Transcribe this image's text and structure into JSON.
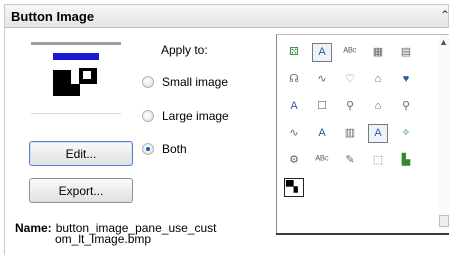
{
  "panel": {
    "title": "Button Image",
    "collapse_icon": "double-chevron-icon"
  },
  "apply": {
    "label": "Apply to:",
    "options": [
      {
        "label": "Small image",
        "checked": false
      },
      {
        "label": "Large image",
        "checked": false
      },
      {
        "label": "Both",
        "checked": true
      }
    ]
  },
  "buttons": {
    "edit": "Edit...",
    "export": "Export..."
  },
  "name": {
    "label": "Name:",
    "value_line1": "button_image_pane_use_cust",
    "value_line2": "om_lt_Image.bmp"
  },
  "gallery": {
    "icons": [
      {
        "name": "puzzle-icon",
        "glyph": "⚄",
        "style": "green"
      },
      {
        "name": "text-box-a-icon",
        "glyph": "A",
        "style": "boxed"
      },
      {
        "name": "abc-spell-icon",
        "glyph": "ᴬᴮᶜ",
        "style": "gray"
      },
      {
        "name": "table-icon",
        "glyph": "▦",
        "style": "gray"
      },
      {
        "name": "form-icon",
        "glyph": "▤",
        "style": "gray"
      },
      {
        "name": "callout-shape-icon",
        "glyph": "☊",
        "style": "gray"
      },
      {
        "name": "waveform-icon",
        "glyph": "∿",
        "style": "gray"
      },
      {
        "name": "heart-callout-icon",
        "glyph": "♡",
        "style": "gray"
      },
      {
        "name": "speech-shape-icon",
        "glyph": "⌂",
        "style": "gray"
      },
      {
        "name": "heart-badge-icon",
        "glyph": "♥",
        "style": ""
      },
      {
        "name": "text-a-underline-icon",
        "glyph": "A",
        "style": ""
      },
      {
        "name": "speech-bubble-icon",
        "glyph": "☐",
        "style": "gray"
      },
      {
        "name": "search-bubble-icon",
        "glyph": "⚲",
        "style": "gray"
      },
      {
        "name": "chat-bubbles-icon",
        "glyph": "⌂",
        "style": "gray"
      },
      {
        "name": "link-bubble-icon",
        "glyph": "⚲",
        "style": "gray"
      },
      {
        "name": "pulse-line-icon",
        "glyph": "∿",
        "style": "gray"
      },
      {
        "name": "text-format-icon",
        "glyph": "A",
        "style": ""
      },
      {
        "name": "document-text-icon",
        "glyph": "▥",
        "style": "gray"
      },
      {
        "name": "text-frame-icon",
        "glyph": "A",
        "style": "boxed"
      },
      {
        "name": "magic-wand-icon",
        "glyph": "✧",
        "style": "green"
      },
      {
        "name": "tools-icon",
        "glyph": "⚙",
        "style": "gray"
      },
      {
        "name": "abc-check-icon",
        "glyph": "ᴬᴮᶜ",
        "style": "gray"
      },
      {
        "name": "hand-document-icon",
        "glyph": "✎",
        "style": "gray"
      },
      {
        "name": "selection-cursor-icon",
        "glyph": "⬚",
        "style": "gray"
      },
      {
        "name": "green-chart-icon",
        "glyph": "▙",
        "style": "green"
      },
      {
        "name": "button-image-selected-icon",
        "glyph": "▀▖",
        "style": "selected"
      }
    ]
  }
}
